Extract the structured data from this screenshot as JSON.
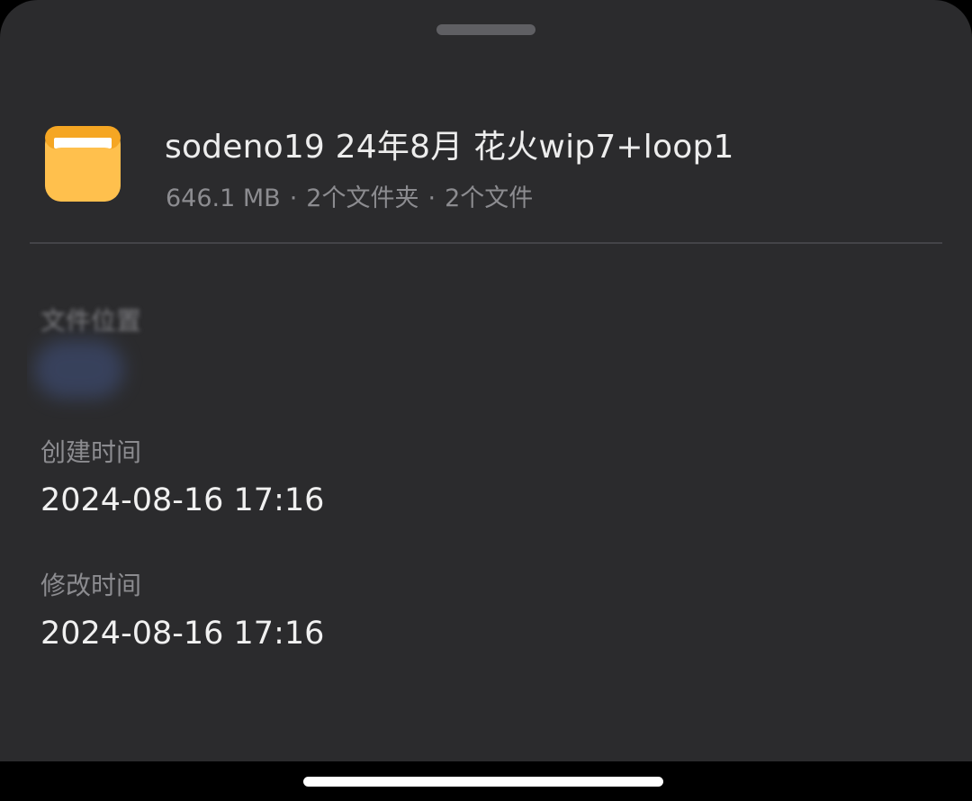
{
  "sheet": {
    "file_name": "sodeno19 24年8月 花火wip7+loop1",
    "size": "646.1 MB",
    "separator": "·",
    "folders": "2个文件夹",
    "files": "2个文件",
    "icon": "folder-icon",
    "icon_color": "#FFC04D"
  },
  "details": {
    "location_label": "文件位置",
    "created_label": "创建时间",
    "created_value": "2024-08-16 17:16",
    "modified_label": "修改时间",
    "modified_value": "2024-08-16 17:16"
  }
}
